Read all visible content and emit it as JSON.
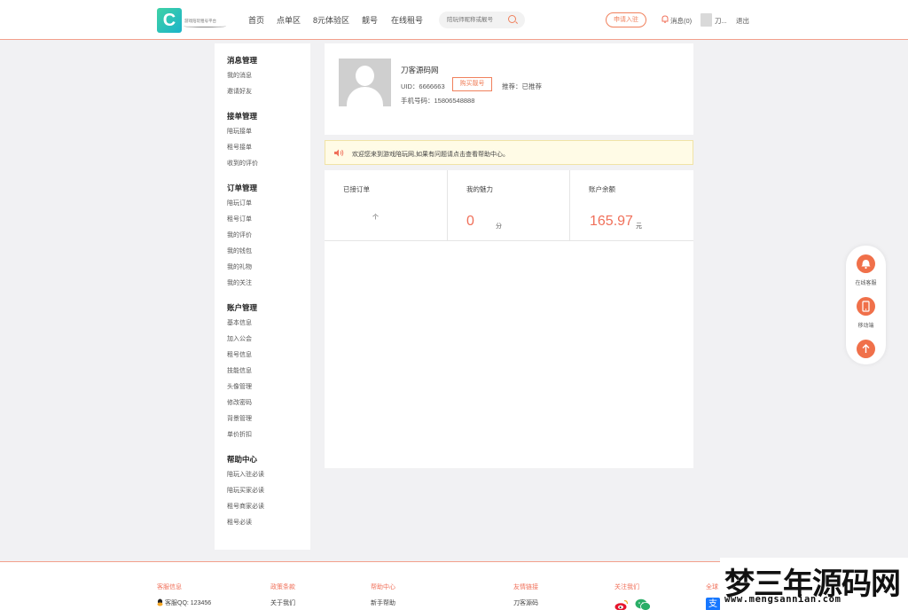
{
  "colors": {
    "accent": "#f0705a",
    "header_border": "#f3a08c",
    "notice_bg": "#fffbe6",
    "page_bg": "#f1f1f3"
  },
  "header": {
    "logo_text": "游戏陪玩租号平台",
    "nav": [
      "首页",
      "点单区",
      "8元体验区",
      "靓号",
      "在线租号"
    ],
    "search_placeholder": "陪玩师昵称或靓号",
    "apply_label": "申请入驻",
    "messages_label": "消息(0)",
    "username": "刀...",
    "logout_label": "退出"
  },
  "sidebar": {
    "sections": [
      {
        "title": "消息管理",
        "items": [
          "我的消息",
          "邀请好友"
        ]
      },
      {
        "title": "接单管理",
        "items": [
          "陪玩接单",
          "租号接单",
          "收到的评价"
        ]
      },
      {
        "title": "订单管理",
        "items": [
          "陪玩订单",
          "租号订单",
          "我的评价",
          "我的钱包",
          "我的礼物",
          "我的关注"
        ]
      },
      {
        "title": "账户管理",
        "items": [
          "基本信息",
          "加入公会",
          "租号信息",
          "技能信息",
          "头像管理",
          "修改密码",
          "背景管理",
          "单价折扣"
        ]
      },
      {
        "title": "帮助中心",
        "items": [
          "陪玩入驻必读",
          "陪玩买家必读",
          "租号商家必读",
          "租号必读"
        ]
      }
    ]
  },
  "profile": {
    "name": "刀客源码网",
    "uid_label": "UID：6666663",
    "buy_button": "购买靓号",
    "recommend": "推荐：已推荐",
    "phone": "手机号码：15806548888"
  },
  "notice": "欢迎您来到游戏陪玩网,如果有问题请点击查看帮助中心。",
  "stats": [
    {
      "label": "已接订单",
      "value": "",
      "unit": "个"
    },
    {
      "label": "我的魅力",
      "value": "0",
      "unit": "分"
    },
    {
      "label": "账户余额",
      "value": "165.97",
      "unit": "元"
    }
  ],
  "float_bar": {
    "service": "在线客服",
    "mobile": "移动端"
  },
  "footer": {
    "cols": [
      {
        "title": "客服信息",
        "item": "客服QQ: 123456"
      },
      {
        "title": "政策条款",
        "item": "关于我们"
      },
      {
        "title": "帮助中心",
        "item": "新手帮助"
      },
      {
        "title": "友情链接",
        "item": "刀客源码"
      },
      {
        "title": "关注我们",
        "item": ""
      },
      {
        "title": "全球",
        "item": ""
      }
    ]
  },
  "watermark": {
    "big": "梦三年源码网",
    "small": "www.mengsannian.com"
  }
}
